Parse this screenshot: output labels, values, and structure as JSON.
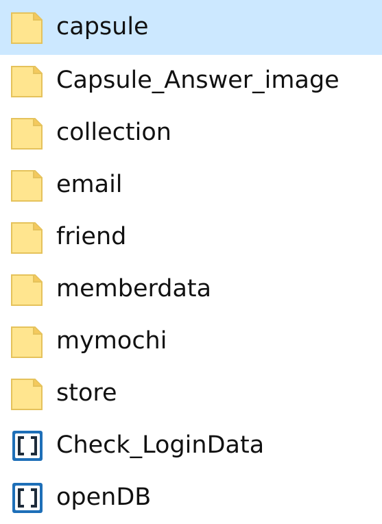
{
  "explorer": {
    "items": [
      {
        "label": "capsule",
        "type": "folder",
        "icon": "folder-icon",
        "selected": true
      },
      {
        "label": "Capsule_Answer_image",
        "type": "folder",
        "icon": "folder-icon",
        "selected": false
      },
      {
        "label": "collection",
        "type": "folder",
        "icon": "folder-icon",
        "selected": false
      },
      {
        "label": "email",
        "type": "folder",
        "icon": "folder-icon",
        "selected": false
      },
      {
        "label": "friend",
        "type": "folder",
        "icon": "folder-icon",
        "selected": false
      },
      {
        "label": "memberdata",
        "type": "folder",
        "icon": "folder-icon",
        "selected": false
      },
      {
        "label": "mymochi",
        "type": "folder",
        "icon": "folder-icon",
        "selected": false
      },
      {
        "label": "store",
        "type": "folder",
        "icon": "folder-icon",
        "selected": false
      },
      {
        "label": "Check_LoginData",
        "type": "file",
        "icon": "script-file-icon",
        "selected": false
      },
      {
        "label": "openDB",
        "type": "file",
        "icon": "script-file-icon",
        "selected": false
      }
    ]
  },
  "colors": {
    "selection": "#cce8ff",
    "folder_fill": "#ffe58f",
    "folder_tab": "#f4c95d",
    "file_icon": "#1e6fb8",
    "text": "#111111"
  }
}
